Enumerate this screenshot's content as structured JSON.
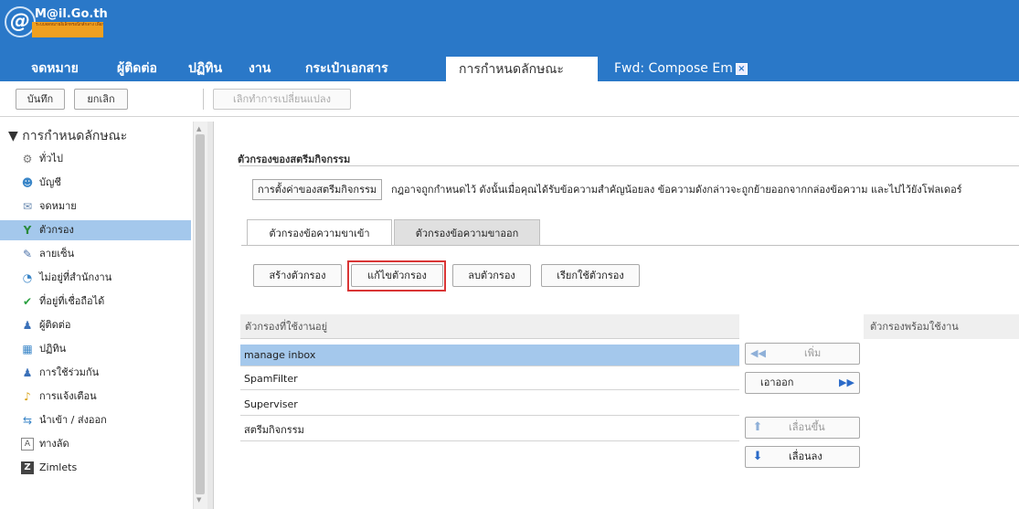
{
  "logo": {
    "brand": "M@il.Go.th",
    "tagline": "ระบบจดหมายอิเล็กทรอนิกส์กลาง เพื่อการสื่อสารในภาครัฐ"
  },
  "app_tabs": [
    {
      "label": "จดหมาย"
    },
    {
      "label": "ผู้ติดต่อ"
    },
    {
      "label": "ปฏิทิน"
    },
    {
      "label": "งาน"
    },
    {
      "label": "กระเป๋าเอกสาร"
    },
    {
      "label": "การกำหนดลักษณะ"
    },
    {
      "label": "Fwd: Compose Em"
    }
  ],
  "toolbar": {
    "save": "บันทึก",
    "cancel": "ยกเลิก",
    "undo": "เลิกทำการเปลี่ยนแปลง"
  },
  "sidebar": {
    "title": "การกำหนดลักษณะ",
    "items": [
      {
        "label": "ทั่วไป",
        "icon": "gear-icon"
      },
      {
        "label": "บัญชี",
        "icon": "accounts-icon"
      },
      {
        "label": "จดหมาย",
        "icon": "mail-icon"
      },
      {
        "label": "ตัวกรอง",
        "icon": "filter-icon"
      },
      {
        "label": "ลายเซ็น",
        "icon": "signature-icon"
      },
      {
        "label": "ไม่อยู่ที่สำนักงาน",
        "icon": "out-of-office-icon"
      },
      {
        "label": "ที่อยู่ที่เชื่อถือได้",
        "icon": "trusted-shield-icon"
      },
      {
        "label": "ผู้ติดต่อ",
        "icon": "contact-icon"
      },
      {
        "label": "ปฏิทิน",
        "icon": "calendar-icon"
      },
      {
        "label": "การใช้ร่วมกัน",
        "icon": "sharing-icon"
      },
      {
        "label": "การแจ้งเตือน",
        "icon": "bell-icon"
      },
      {
        "label": "นำเข้า / ส่งออก",
        "icon": "import-export-icon"
      },
      {
        "label": "ทางลัด",
        "icon": "shortcut-key-icon"
      },
      {
        "label": "Zimlets",
        "icon": "zimlet-icon"
      }
    ]
  },
  "main": {
    "section_title": "ตัวกรองของสตรีมกิจกรรม",
    "activity_settings_button": "การตั้งค่าของสตรีมกิจกรรม",
    "description": "กฎอาจถูกกำหนดไว้ ดังนั้นเมื่อคุณได้รับข้อความสำคัญน้อยลง ข้อความดังกล่าวจะถูกย้ายออกจากกล่องข้อความ และไปไว้ยังโฟลเดอร์",
    "tabs": [
      {
        "label": "ตัวกรองข้อความขาเข้า"
      },
      {
        "label": "ตัวกรองข้อความขาออก"
      }
    ],
    "actions": {
      "create": "สร้างตัวกรอง",
      "edit": "แก้ไขตัวกรอง",
      "delete": "ลบตัวกรอง",
      "run": "เรียกใช้ตัวกรอง"
    },
    "active_header": "ตัวกรองที่ใช้งานอยู่",
    "active_filters": [
      "manage inbox",
      "SpamFilter",
      "Superviser",
      "สตรีมกิจกรรม"
    ],
    "available_header": "ตัวกรองพร้อมใช้งาน",
    "move": {
      "add": "เพิ่ม",
      "remove": "เอาออก",
      "up": "เลื่อนขึ้น",
      "down": "เลื่อนลง"
    }
  }
}
